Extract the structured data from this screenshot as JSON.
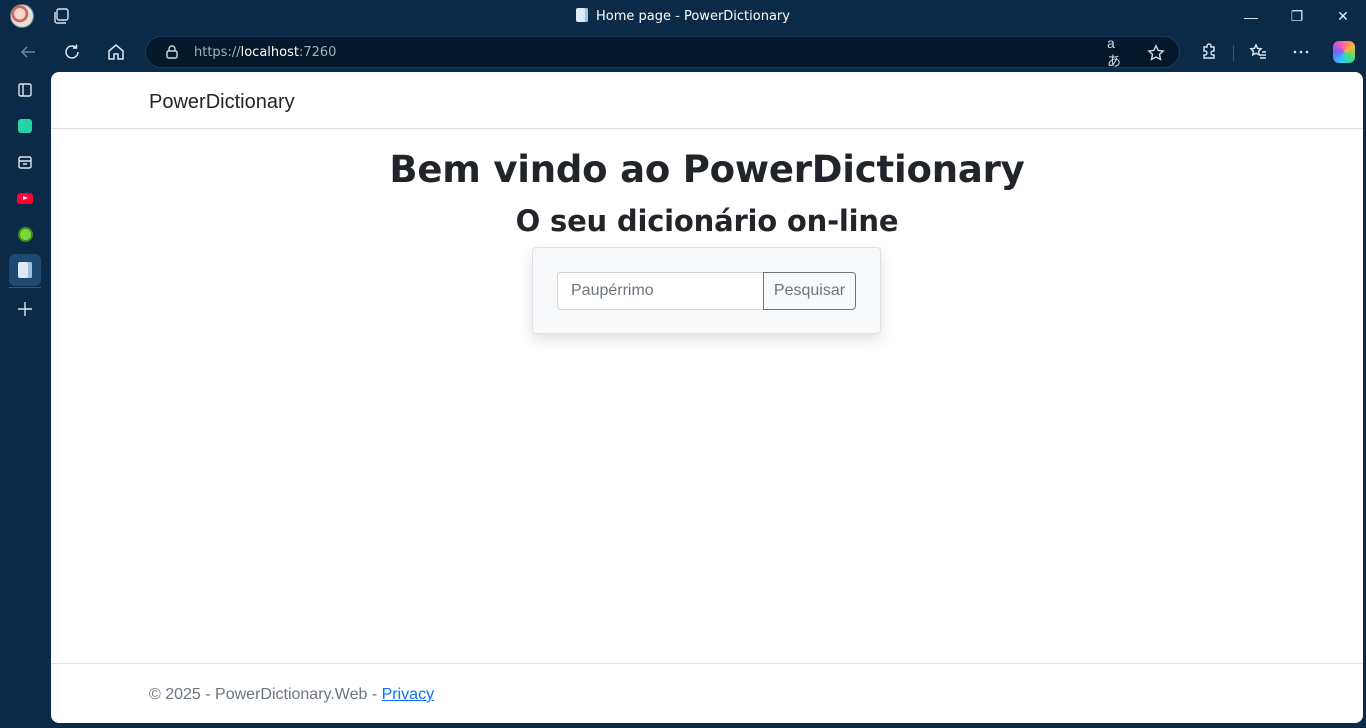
{
  "window": {
    "title": "Home page - PowerDictionary",
    "controls": {
      "minimize": "—",
      "maximize": "❐",
      "close": "✕"
    }
  },
  "toolbar": {
    "url_scheme": "https://",
    "url_host": "localhost",
    "url_port": ":7260",
    "read_aloud_glyph": "aあ"
  },
  "sidebar": {
    "items": [
      {
        "name": "sidebar-item-collections",
        "color": "#dce7f1"
      },
      {
        "name": "sidebar-item-app-green",
        "color": "#25d3a4"
      },
      {
        "name": "sidebar-item-tools",
        "color": "#dce7f1"
      },
      {
        "name": "sidebar-item-youtube",
        "color": "#ff0033"
      },
      {
        "name": "sidebar-item-app-lime",
        "color": "#7ad83b"
      },
      {
        "name": "sidebar-item-active-page",
        "color": "#dfe9f3"
      }
    ]
  },
  "page": {
    "brand": "PowerDictionary",
    "heading": "Bem vindo ao PowerDictionary",
    "subheading": "O seu dicionário on-line",
    "search": {
      "placeholder": "Paupérrimo",
      "button_label": "Pesquisar"
    },
    "footer": {
      "text": "© 2025 - PowerDictionary.Web - ",
      "link_label": "Privacy",
      "link_color": "#0d6efd"
    }
  }
}
